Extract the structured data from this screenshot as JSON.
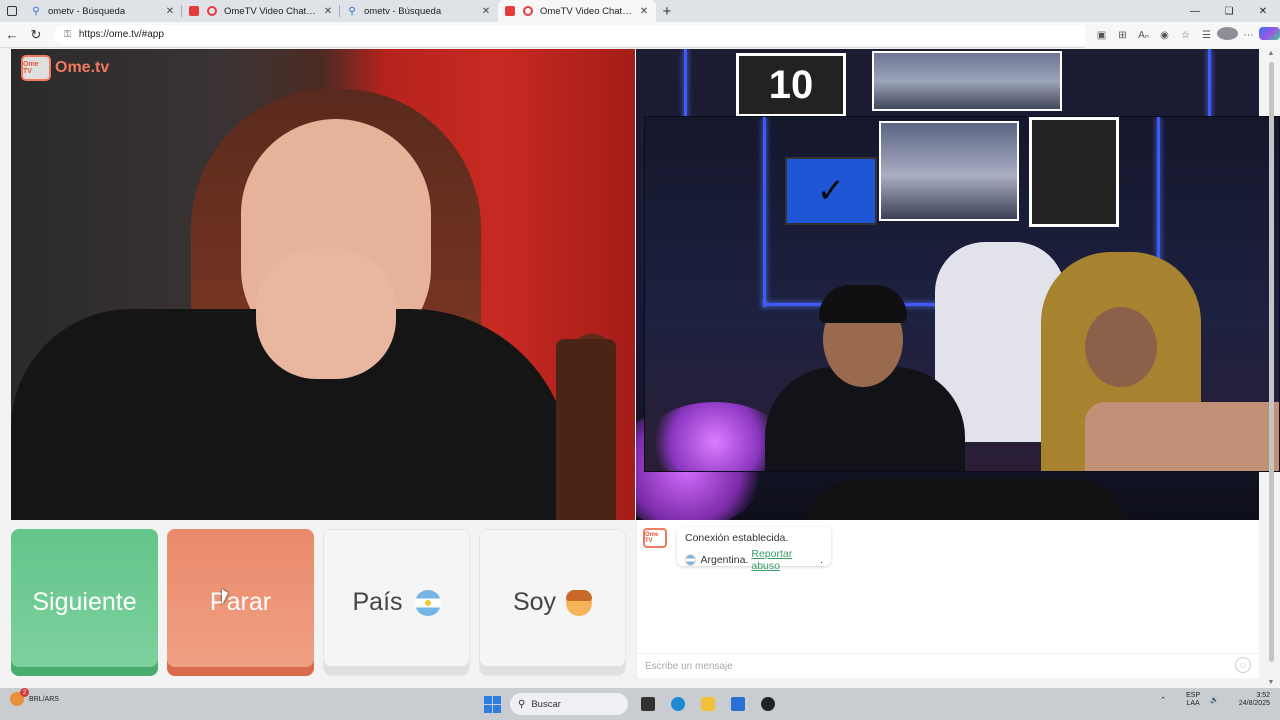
{
  "browser": {
    "tabs": [
      {
        "title": "ometv - Búsqueda",
        "favicon": "search-icon",
        "active": false
      },
      {
        "title": "OmeTV Video Chat — Omegle",
        "favicon": "video-icon",
        "active": false
      },
      {
        "title": "ometv - Búsqueda",
        "favicon": "search-icon",
        "active": false
      },
      {
        "title": "OmeTV Video Chat — Omegle",
        "favicon": "video-icon",
        "active": true
      }
    ],
    "url": "https://ome.tv/#app"
  },
  "site": {
    "logo_text": "Ome.tv",
    "logo_tv_text": "Ome TV"
  },
  "buttons": {
    "next_label": "Siguiente",
    "stop_label": "Parar",
    "country_label": "País",
    "gender_label": "Soy"
  },
  "chat": {
    "status_message": "Conexión establecida.",
    "country_name": "Argentina.",
    "report_label": "Reportar abuso",
    "report_suffix": ".",
    "input_placeholder": "Escribe un mensaje"
  },
  "video_right": {
    "jersey_number": "10"
  },
  "taskbar": {
    "weather_line1": "BRL/ARS",
    "weather_badge": "2",
    "search_label": "Buscar",
    "lang_line1": "ESP",
    "lang_line2": "LAA",
    "time": "3:52",
    "date": "24/8/2025"
  },
  "colors": {
    "next_button": "#63c58a",
    "stop_button": "#ea8a6c",
    "logo_accent": "#ef7a5d",
    "link": "#3a9c6a"
  }
}
